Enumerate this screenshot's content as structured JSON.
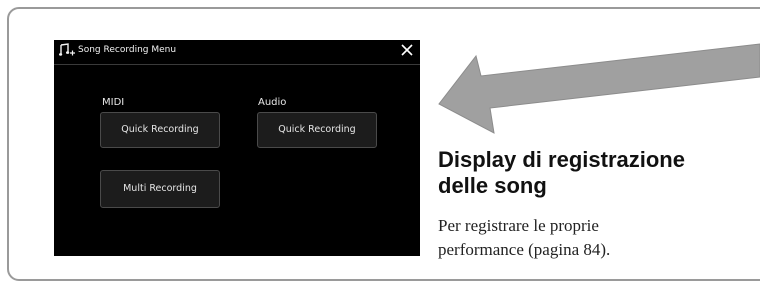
{
  "window": {
    "title": "Song Recording Menu",
    "icon": "music-notes-plus-icon",
    "close_icon": "close-icon"
  },
  "midi": {
    "label": "MIDI",
    "buttons": [
      "Quick Recording",
      "Multi Recording"
    ]
  },
  "audio": {
    "label": "Audio",
    "buttons": [
      "Quick Recording"
    ]
  },
  "caption": {
    "heading_line1": "Display di registrazione",
    "heading_line2": "delle song",
    "desc_line1": "Per registrare le proprie",
    "desc_line2": "performance (pagina 84)."
  },
  "colors": {
    "screen_bg": "#000000",
    "button_bg": "#1c1c1c",
    "arrow": "#a0a0a0",
    "frame_border": "#9a9a9a"
  }
}
